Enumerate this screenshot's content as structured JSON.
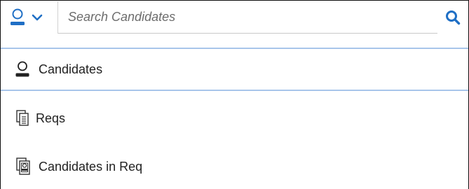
{
  "search": {
    "placeholder": "Search Candidates",
    "value": "",
    "scope_icon": "person-icon",
    "scope_chevron_icon": "chevron-down-icon",
    "submit_icon": "search-icon"
  },
  "dropdown": {
    "items": [
      {
        "label": "Candidates",
        "icon": "person-icon"
      },
      {
        "label": "Reqs",
        "icon": "document-icon"
      },
      {
        "label": "Candidates in Req",
        "icon": "candidate-document-icon"
      }
    ]
  },
  "colors": {
    "accent_blue": "#1f6fc5",
    "divider_blue": "#a8c5ea",
    "text": "#222222",
    "placeholder_text": "#6c6c6c"
  }
}
